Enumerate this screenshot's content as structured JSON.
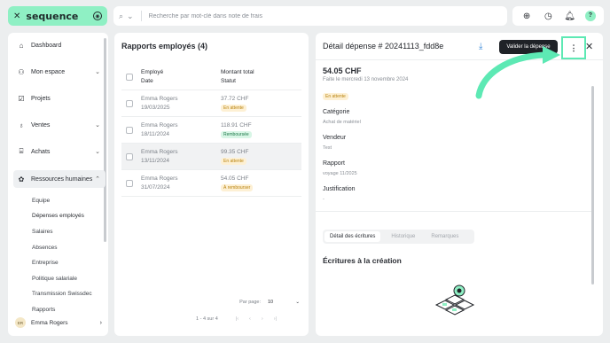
{
  "app": {
    "logo_text": "sequence"
  },
  "search": {
    "placeholder": "Recherche par mot-clé dans note de frais"
  },
  "sidebar": {
    "items": [
      {
        "label": "Dashboard"
      },
      {
        "label": "Mon espace"
      },
      {
        "label": "Projets"
      },
      {
        "label": "Ventes"
      },
      {
        "label": "Achats"
      },
      {
        "label": "Ressources humaines"
      }
    ],
    "subitems": [
      {
        "label": "Equipe"
      },
      {
        "label": "Dépenses employés"
      },
      {
        "label": "Salaires"
      },
      {
        "label": "Absences"
      },
      {
        "label": "Entreprise"
      },
      {
        "label": "Politique salariale"
      },
      {
        "label": "Transmission Swissdec"
      },
      {
        "label": "Rapports"
      }
    ],
    "user": {
      "initials": "ER",
      "name": "Emma Rogers"
    }
  },
  "reports": {
    "title": "Rapports employés (4)",
    "headers": {
      "employee": "Employé",
      "date": "Date",
      "amount": "Montant total",
      "status": "Statut"
    },
    "rows": [
      {
        "employee": "Emma Rogers",
        "date": "19/03/2025",
        "amount": "37.72 CHF",
        "status": "En attente"
      },
      {
        "employee": "Emma Rogers",
        "date": "18/11/2024",
        "amount": "118.91 CHF",
        "status": "Remboursée"
      },
      {
        "employee": "Emma Rogers",
        "date": "13/11/2024",
        "amount": "99.35 CHF",
        "status": "En attente"
      },
      {
        "employee": "Emma Rogers",
        "date": "31/07/2024",
        "amount": "54.05 CHF",
        "status": "À rembourser"
      }
    ],
    "per_page_label": "Par page:",
    "per_page_value": "10",
    "range": "1 - 4 sur 4"
  },
  "detail": {
    "title": "Détail dépense # 20241113_fdd8e",
    "validate_label": "Valider la dépense",
    "amount": "54.05 CHF",
    "date": "Faite le mercredi 13 novembre 2024",
    "status": "En attente",
    "fields": [
      {
        "label": "Catégorie",
        "value": "Achat de matériel"
      },
      {
        "label": "Vendeur",
        "value": "Test"
      },
      {
        "label": "Rapport",
        "value": "voyage 11/2025"
      },
      {
        "label": "Justification",
        "value": "-"
      }
    ],
    "tabs": [
      "Détail des écritures",
      "Historique",
      "Remarques"
    ],
    "section_title": "Écritures à la création"
  },
  "colors": {
    "accent": "#8ff0c4",
    "highlight": "#5de9b4",
    "warn_bg": "#fdf0d4",
    "ok_bg": "#d8f6e6"
  }
}
